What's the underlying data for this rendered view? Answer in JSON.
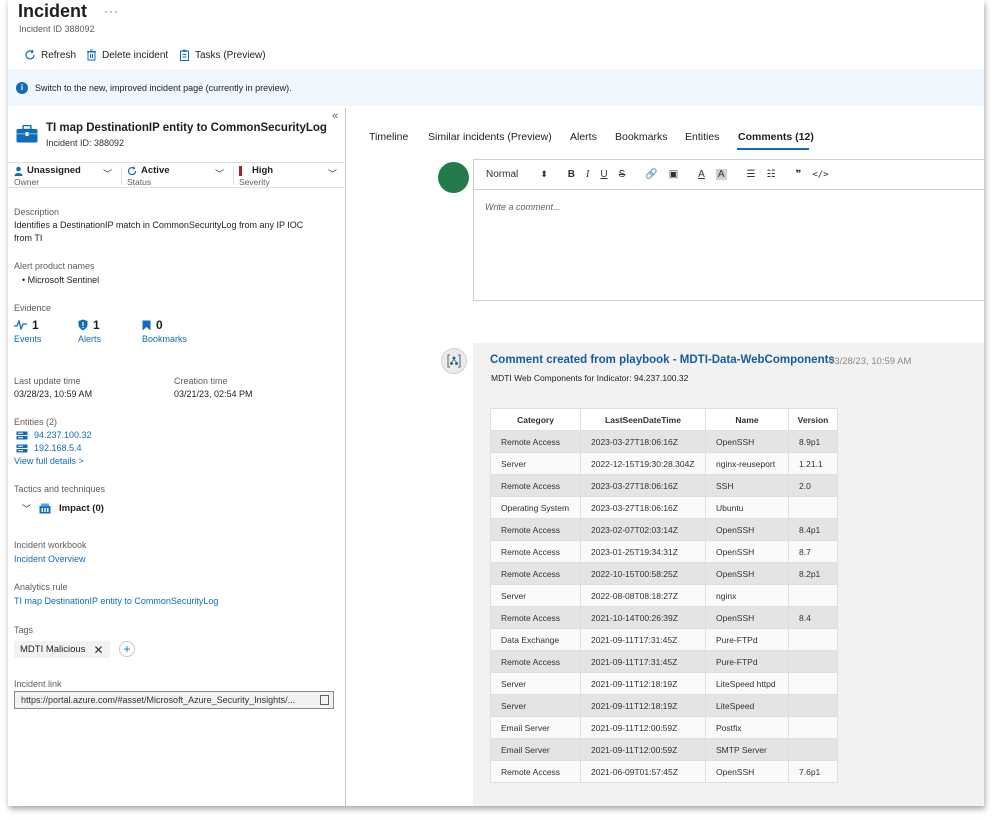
{
  "header": {
    "title": "Incident",
    "more": "···",
    "incident_id": "Incident ID 388092",
    "commands": {
      "refresh": "Refresh",
      "delete": "Delete incident",
      "tasks": "Tasks (Preview)"
    },
    "banner": "Switch to the new, improved incident page (currently in preview)."
  },
  "left": {
    "collapse": "«",
    "title": "TI map DestinationIP entity to CommonSecurityLog",
    "id": "Incident ID: 388092",
    "owner": {
      "value": "Unassigned",
      "label": "Owner"
    },
    "status": {
      "value": "Active",
      "label": "Status"
    },
    "severity": {
      "value": "High",
      "label": "Severity",
      "color": "#a4262c"
    },
    "description_label": "Description",
    "description_line1": "Identifies a DestinationIP match in CommonSecurityLog from any IP IOC",
    "description_line2": "from TI",
    "alert_products_label": "Alert product names",
    "alert_product": "Microsoft Sentinel",
    "evidence_label": "Evidence",
    "evidence": {
      "events": {
        "count": "1",
        "label": "Events"
      },
      "alerts": {
        "count": "1",
        "label": "Alerts"
      },
      "bookmarks": {
        "count": "0",
        "label": "Bookmarks"
      }
    },
    "last_update_label": "Last update time",
    "last_update": "03/28/23, 10:59 AM",
    "creation_label": "Creation time",
    "creation": "03/21/23, 02:54 PM",
    "entities_label": "Entities (2)",
    "entity1": "94.237.100.32",
    "entity2": "192.168.5.4",
    "view_full": "View full details >",
    "tactics_label": "Tactics and techniques",
    "tactic": "Impact (0)",
    "workbook_label": "Incident workbook",
    "workbook": "Incident Overview",
    "analytics_label": "Analytics rule",
    "analytics": "TI map DestinationIP entity to CommonSecurityLog",
    "tags_label": "Tags",
    "tag": "MDTI Malicious",
    "link_label": "Incident link",
    "link": "https://portal.azure.com/#asset/Microsoft_Azure_Security_Insights/..."
  },
  "tabs": [
    "Timeline",
    "Similar incidents (Preview)",
    "Alerts",
    "Bookmarks",
    "Entities",
    "Comments (12)"
  ],
  "editor": {
    "format": "Normal",
    "placeholder": "Write a comment..."
  },
  "comment": {
    "title": "Comment created from playbook - MDTI-Data-WebComponents",
    "time": "03/28/23, 10:59 AM",
    "desc": "MDTI Web Components for Indicator: 94.237.100.32",
    "columns": [
      "Category",
      "LastSeenDateTime",
      "Name",
      "Version"
    ],
    "rows": [
      [
        "Remote Access",
        "2023-03-27T18:06:16Z",
        "OpenSSH",
        "8.9p1"
      ],
      [
        "Server",
        "2022-12-15T19:30:28.304Z",
        "nginx-reuseport",
        "1.21.1"
      ],
      [
        "Remote Access",
        "2023-03-27T18:06:16Z",
        "SSH",
        "2.0"
      ],
      [
        "Operating System",
        "2023-03-27T18:06:16Z",
        "Ubuntu",
        ""
      ],
      [
        "Remote Access",
        "2023-02-07T02:03:14Z",
        "OpenSSH",
        "8.4p1"
      ],
      [
        "Remote Access",
        "2023-01-25T19:34:31Z",
        "OpenSSH",
        "8.7"
      ],
      [
        "Remote Access",
        "2022-10-15T00:58:25Z",
        "OpenSSH",
        "8.2p1"
      ],
      [
        "Server",
        "2022-08-08T08:18:27Z",
        "nginx",
        ""
      ],
      [
        "Remote Access",
        "2021-10-14T00:26:39Z",
        "OpenSSH",
        "8.4"
      ],
      [
        "Data Exchange",
        "2021-09-11T17:31:45Z",
        "Pure-FTPd",
        ""
      ],
      [
        "Remote Access",
        "2021-09-11T17:31:45Z",
        "Pure-FTPd",
        ""
      ],
      [
        "Server",
        "2021-09-11T12:18:19Z",
        "LiteSpeed httpd",
        ""
      ],
      [
        "Server",
        "2021-09-11T12:18:19Z",
        "LiteSpeed",
        ""
      ],
      [
        "Email Server",
        "2021-09-11T12:00:59Z",
        "Postfix",
        ""
      ],
      [
        "Email Server",
        "2021-09-11T12:00:59Z",
        "SMTP Server",
        ""
      ],
      [
        "Remote Access",
        "2021-06-09T01:57:45Z",
        "OpenSSH",
        "7.6p1"
      ]
    ]
  },
  "colors": {
    "accent": "#0f6cbd",
    "avatar": "#237b4b",
    "banner": "#eff6fc"
  }
}
